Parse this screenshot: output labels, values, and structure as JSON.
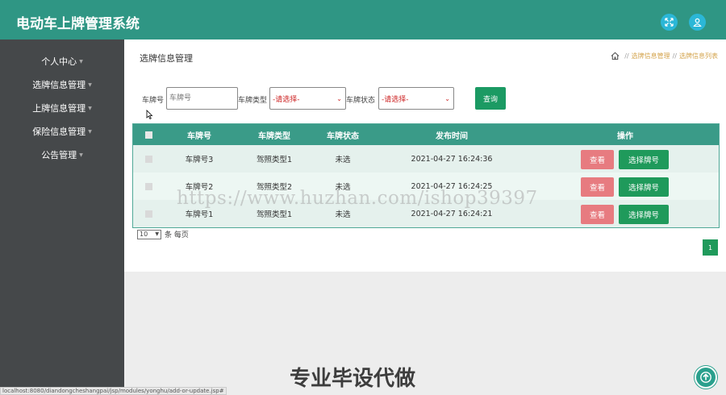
{
  "app": {
    "title": "电动车上牌管理系统"
  },
  "header": {
    "icons": [
      "fullscreen-icon",
      "user-icon"
    ],
    "color": "#2f9684"
  },
  "sidebar": {
    "items": [
      {
        "label": "个人中心"
      },
      {
        "label": "选牌信息管理"
      },
      {
        "label": "上牌信息管理"
      },
      {
        "label": "保险信息管理"
      },
      {
        "label": "公告管理"
      }
    ]
  },
  "page": {
    "title": "选牌信息管理",
    "breadcrumb": [
      "选牌信息管理",
      "选牌信息列表"
    ]
  },
  "search": {
    "plate_label": "车牌号",
    "plate_placeholder": "车牌号",
    "type_label": "车牌类型",
    "type_value": "-请选择-",
    "status_label": "车牌状态",
    "status_value": "-请选择-",
    "button": "查询"
  },
  "table": {
    "columns": [
      "车牌号",
      "车牌类型",
      "车牌状态",
      "发布时间",
      "操作"
    ],
    "rows": [
      {
        "plate": "车牌号3",
        "type": "驾照类型1",
        "status": "未选",
        "time": "2021-04-27 16:24:36",
        "view": "查看",
        "pick": "选择牌号"
      },
      {
        "plate": "车牌号2",
        "type": "驾照类型2",
        "status": "未选",
        "time": "2021-04-27 16:24:25",
        "view": "查看",
        "pick": "选择牌号"
      },
      {
        "plate": "车牌号1",
        "type": "驾照类型1",
        "status": "未选",
        "time": "2021-04-27 16:24:21",
        "view": "查看",
        "pick": "选择牌号"
      }
    ]
  },
  "pagination": {
    "page_size": "10",
    "page_size_suffix": "条 每页",
    "current_page": "1"
  },
  "status_bar": {
    "url": "localhost:8080/diandongcheshangpai/jsp/modules/yonghu/add-or-update.jsp#"
  },
  "overlay": {
    "watermark": "https://www.huzhan.com/ishop39397",
    "promo": "专业毕设代做"
  },
  "colors": {
    "accent": "#2f9684",
    "view_button": "#e77b80",
    "pick_button": "#1f9a5b",
    "sidebar": "#45484a"
  }
}
